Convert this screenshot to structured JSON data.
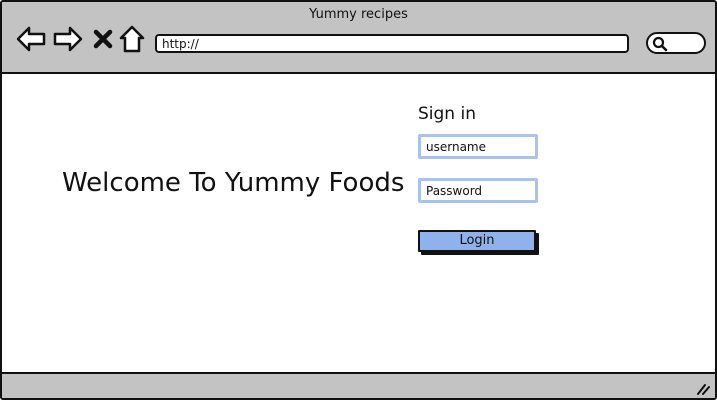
{
  "window": {
    "title": "Yummy recipes"
  },
  "toolbar": {
    "back_icon": "arrow-left-icon",
    "forward_icon": "arrow-right-icon",
    "stop_icon": "close-icon",
    "home_icon": "home-icon",
    "address_value": "http://",
    "search_icon": "search-icon"
  },
  "main": {
    "welcome_text": "Welcome To Yummy Foods",
    "sign_in": {
      "title": "Sign in",
      "username_placeholder": "username",
      "password_placeholder": "Password",
      "login_label": "Login"
    }
  },
  "colors": {
    "chrome": "#c3c3c3",
    "field_border": "#a7c3ee",
    "button_fill": "#8fb2ec"
  }
}
